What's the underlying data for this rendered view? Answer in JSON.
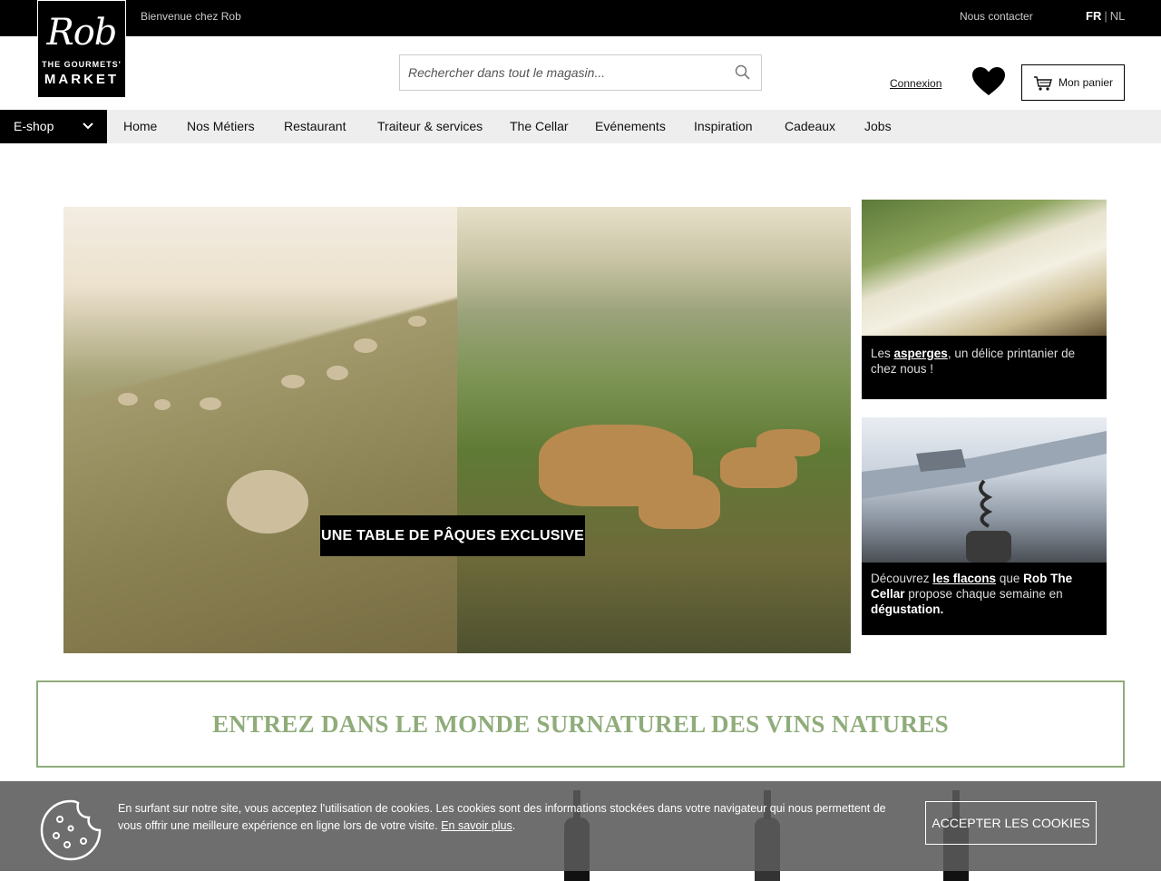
{
  "topbar": {
    "welcome": "Bienvenue chez Rob",
    "contact": "Nous contacter",
    "lang_fr": "FR",
    "lang_sep": "|",
    "lang_nl": "NL"
  },
  "logo": {
    "script": "Rob",
    "line1": "THE GOURMETS'",
    "line2": "MARKET"
  },
  "header": {
    "search_placeholder": "Rechercher dans tout le magasin...",
    "login": "Connexion",
    "cart": "Mon panier"
  },
  "nav": {
    "eshop": "E-shop",
    "items": [
      "Home",
      "Nos Métiers",
      "Restaurant",
      "Traiteur & services",
      "The Cellar",
      "Evénements",
      "Inspiration",
      "Cadeaux",
      "Jobs"
    ]
  },
  "hero": {
    "caption": "UNE TABLE DE PÂQUES EXCLUSIVE"
  },
  "promo1": {
    "pre": "Les ",
    "link": "asperges",
    "post": ", un délice printanier de chez nous !"
  },
  "promo2": {
    "pre": "Découvrez ",
    "link": "les flacons",
    "mid": " que ",
    "brand": "Rob The Cellar",
    "post": " propose chaque semaine en ",
    "end": "dégustation."
  },
  "banner": {
    "title": "ENTREZ DANS LE MONDE SURNATUREL DES VINS NATURES"
  },
  "cookie": {
    "text": "En surfant sur notre site, vous acceptez l'utilisation de cookies. Les cookies sont des informations stockées dans votre navigateur qui nous permettent de vous offrir une meilleure expérience en ligne lors de votre visite. ",
    "link": "En savoir plus",
    "tail": ".",
    "accept": "ACCEPTER LES COOKIES"
  },
  "colors": {
    "accent_green": "#8fac7a",
    "topbar": "#000000",
    "nav_bg": "#eeeeee"
  },
  "icons": [
    "search-icon",
    "heart-icon",
    "cart-icon",
    "chevron-down-icon",
    "cookie-icon"
  ]
}
